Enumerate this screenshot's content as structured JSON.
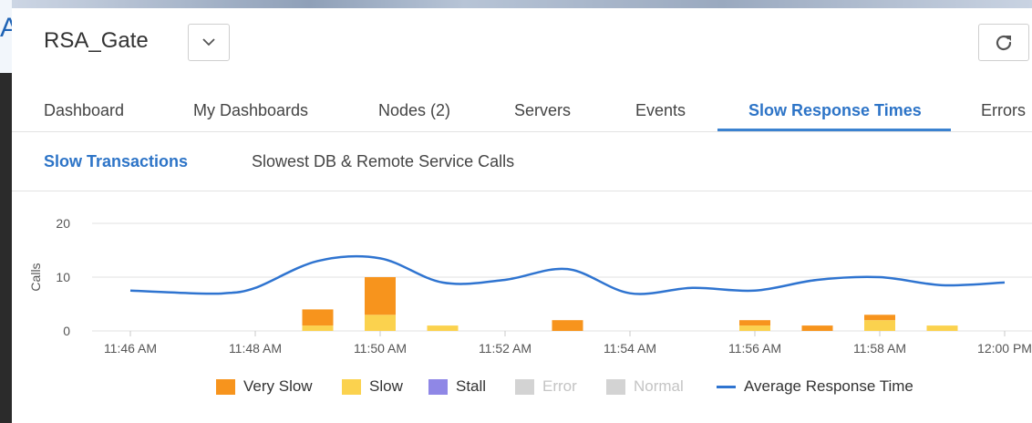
{
  "background_logo": "Al",
  "header": {
    "title": "RSA_Gate",
    "dropdown_icon": "chevron-down-icon",
    "refresh_icon": "refresh-icon"
  },
  "tabs": [
    {
      "label": "Dashboard",
      "active": false
    },
    {
      "label": "My Dashboards",
      "active": false
    },
    {
      "label": "Nodes (2)",
      "active": false
    },
    {
      "label": "Servers",
      "active": false
    },
    {
      "label": "Events",
      "active": false
    },
    {
      "label": "Slow Response Times",
      "active": true
    },
    {
      "label": "Errors",
      "active": false
    }
  ],
  "subtabs": [
    {
      "label": "Slow Transactions",
      "active": true
    },
    {
      "label": "Slowest DB & Remote Service Calls",
      "active": false
    }
  ],
  "colors": {
    "accent": "#2d74c7",
    "very_slow": "#f7941d",
    "slow": "#fbd24e",
    "stall": "#8f87e6",
    "error": "#d3d3d3",
    "normal": "#d3d3d3",
    "avg_line": "#2f74d0"
  },
  "chart_data": {
    "type": "bar",
    "ylabel": "Calls",
    "ylim": [
      0,
      20
    ],
    "yticks": [
      0,
      10,
      20
    ],
    "xlim": [
      0,
      14
    ],
    "x_ticks": [
      {
        "x": 0,
        "label": "11:46 AM"
      },
      {
        "x": 2,
        "label": "11:48 AM"
      },
      {
        "x": 4,
        "label": "11:50 AM"
      },
      {
        "x": 6,
        "label": "11:52 AM"
      },
      {
        "x": 8,
        "label": "11:54 AM"
      },
      {
        "x": 10,
        "label": "11:56 AM"
      },
      {
        "x": 12,
        "label": "11:58 AM"
      },
      {
        "x": 14,
        "label": "12:00 PM"
      }
    ],
    "grid": true,
    "legend_position": "bottom",
    "stacked_bars": [
      {
        "x": 3,
        "slow": 1,
        "very_slow": 3
      },
      {
        "x": 4,
        "slow": 3,
        "very_slow": 7
      },
      {
        "x": 5,
        "slow": 1,
        "very_slow": 0
      },
      {
        "x": 7,
        "slow": 0,
        "very_slow": 2
      },
      {
        "x": 10,
        "slow": 1,
        "very_slow": 1
      },
      {
        "x": 11,
        "slow": 0,
        "very_slow": 1
      },
      {
        "x": 12,
        "slow": 2,
        "very_slow": 1
      },
      {
        "x": 13,
        "slow": 1,
        "very_slow": 0
      }
    ],
    "series": [
      {
        "name": "Very Slow",
        "kind": "bar"
      },
      {
        "name": "Slow",
        "kind": "bar"
      },
      {
        "name": "Stall",
        "kind": "bar"
      },
      {
        "name": "Error",
        "kind": "bar"
      },
      {
        "name": "Normal",
        "kind": "bar"
      },
      {
        "name": "Average Response Time",
        "kind": "line",
        "x": [
          0,
          1,
          1.5,
          2,
          3,
          4,
          5,
          6,
          7,
          8,
          9,
          10,
          11,
          12,
          13,
          14
        ],
        "values": [
          7.5,
          7,
          7,
          8,
          13,
          13.5,
          9,
          9.5,
          11.5,
          7,
          8,
          7.5,
          9.5,
          10,
          8.5,
          9
        ]
      }
    ]
  }
}
